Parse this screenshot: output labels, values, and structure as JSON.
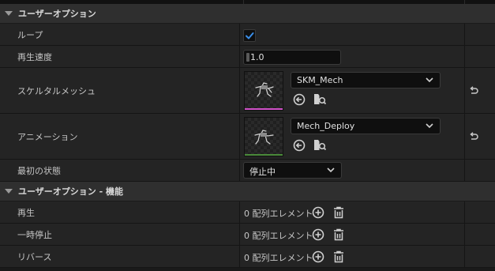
{
  "sections": {
    "user_options": "ユーザーオプション",
    "user_options_functions": "ユーザーオプション - 機能"
  },
  "properties": {
    "loop": {
      "label": "ループ",
      "checked": true
    },
    "play_rate": {
      "label": "再生速度",
      "value": "1.0"
    },
    "skeletal_mesh": {
      "label": "スケルタルメッシュ",
      "value": "SKM_Mech",
      "accent": "#d050c8"
    },
    "animation": {
      "label": "アニメーション",
      "value": "Mech_Deploy",
      "accent": "#4a8a3a"
    },
    "initial_state": {
      "label": "最初の状態",
      "value": "停止中"
    }
  },
  "functions": [
    {
      "label": "再生",
      "count": "0 配列エレメント"
    },
    {
      "label": "一時停止",
      "count": "0 配列エレメント"
    },
    {
      "label": "リバース",
      "count": "0 配列エレメント"
    }
  ],
  "icons": {
    "use_selected": "arrow-left-circle-icon",
    "browse": "browse-asset-icon",
    "reset": "reset-arrow-icon",
    "add": "plus-circle-icon",
    "delete": "trash-icon",
    "check": "checkmark-icon",
    "dropdown": "chevron-down-icon"
  }
}
